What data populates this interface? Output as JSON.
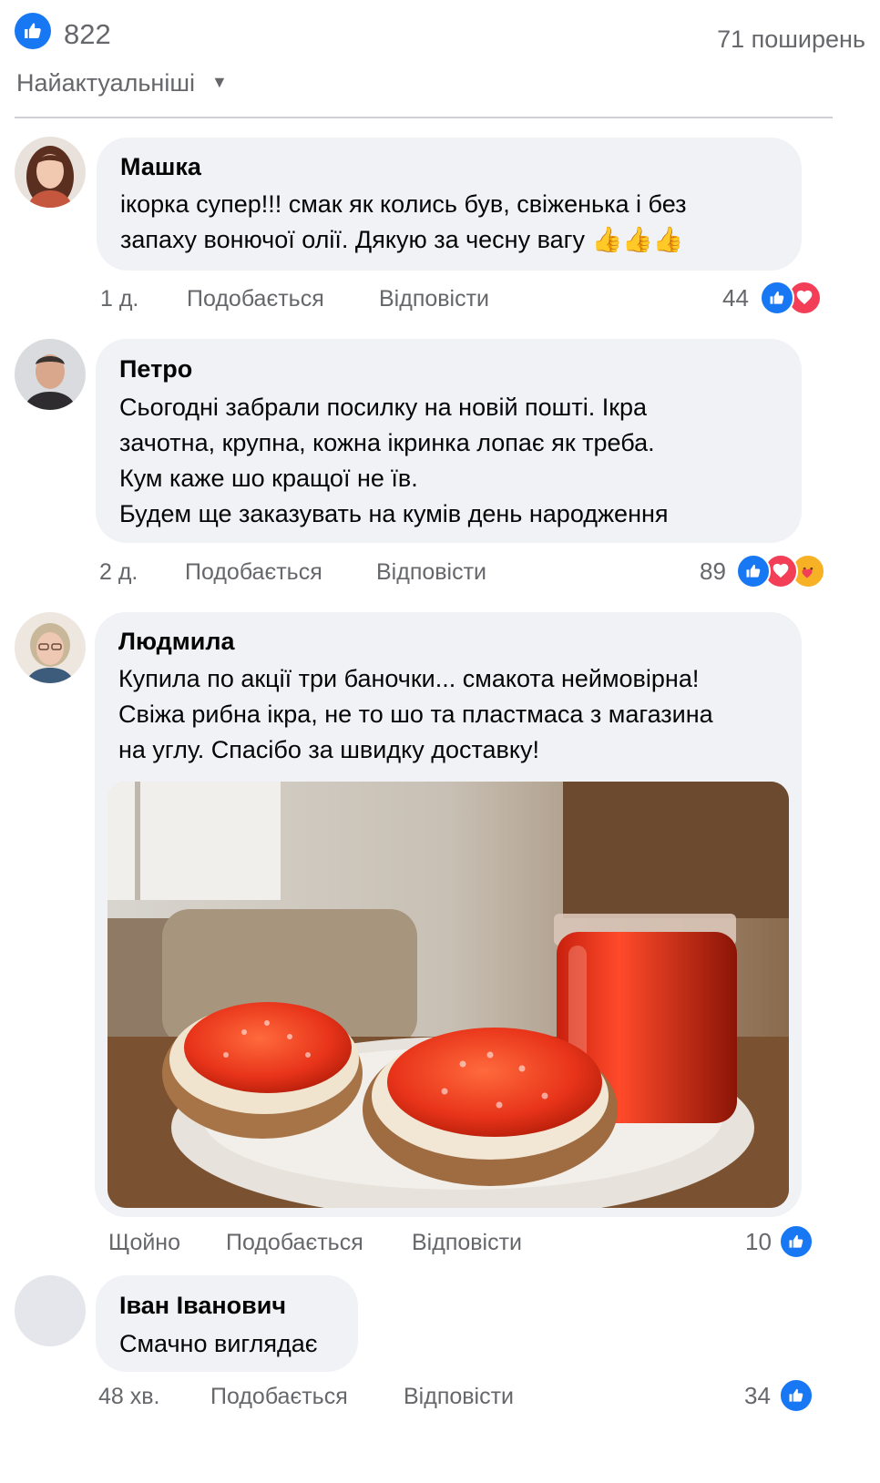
{
  "header": {
    "likes_count": "822",
    "shares": "71 поширень",
    "sort_label": "Найактуальніші",
    "sort_arrow": "▼"
  },
  "comments": [
    {
      "author": "Машка",
      "text": "ікорка супер!!! смак як колись був, свіженька і без\nзапаху вонючої олії. Дякую за чесну вагу 👍👍👍",
      "time": "1 д.",
      "like_label": "Подобається",
      "reply_label": "Відповісти",
      "reactions_count": "44",
      "reactions": [
        "like-icon",
        "love-icon"
      ]
    },
    {
      "author": "Петро",
      "text": "Сьогодні забрали посилку на новій пошті. Ікра\nзачотна, крупна, кожна ікринка лопає як треба.\nКум каже шо кращої не їв.\nБудем ще заказувать на кумів день народження",
      "time": "2 д.",
      "like_label": "Подобається",
      "reply_label": "Відповісти",
      "reactions_count": "89",
      "reactions": [
        "like-icon",
        "love-icon",
        "care-icon"
      ]
    },
    {
      "author": "Людмила",
      "text": "Купила по акції три баночки... смакота неймовірна!\nСвіжа рибна ікра, не то шо та пластмаса з магазина\nна углу. Спасібо за швидку доставку!",
      "time": "Щойно",
      "like_label": "Подобається",
      "reply_label": "Відповісти",
      "reactions_count": "10",
      "reactions": [
        "like-icon"
      ]
    },
    {
      "author": "Іван Іванович",
      "text": "Смачно виглядає",
      "time": "48 хв.",
      "like_label": "Подобається",
      "reply_label": "Відповісти",
      "reactions_count": "34",
      "reactions": [
        "like-icon"
      ]
    }
  ],
  "colors": {
    "accent": "#1877f2",
    "bubble": "#f0f2f5",
    "meta": "#65676b",
    "love": "#f33e58"
  }
}
